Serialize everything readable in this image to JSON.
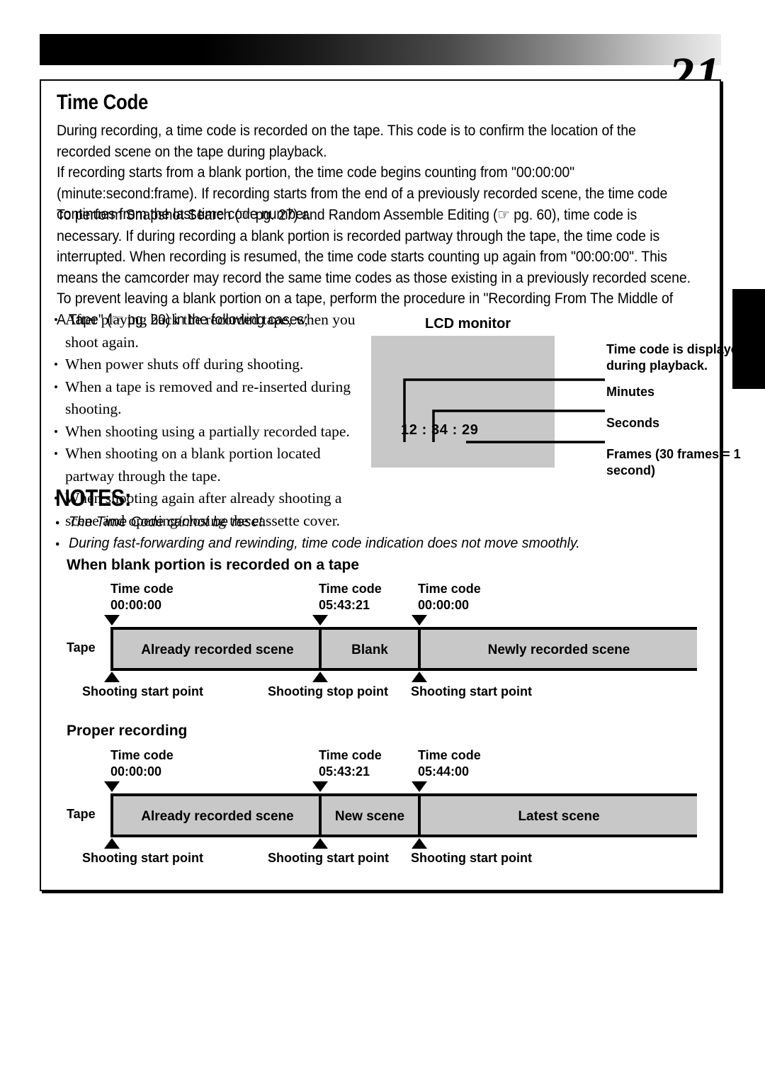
{
  "page": {
    "number": "21",
    "section_title": "Time Code"
  },
  "body": {
    "paragraph_1": "During recording, a time code is recorded on the tape. This code is to confirm the location of the\nrecorded scene on the tape during playback.\nIf recording starts from a blank portion, the time code begins counting from \"00:00:00\"\n(minute:second:frame). If recording starts from the end of a previously recorded scene, the time code\ncontinues from the last time code number.",
    "paragraph_2": "To perform Snapshot Search (☞ pg. 27) and Random Assemble Editing (☞ pg. 60), time code is\nnecessary. If during recording a blank portion is recorded partway through the tape, the time code is\ninterrupted. When recording is resumed, the time code starts counting up again from \"00:00:00\". This\nmeans the camcorder may record the same time codes as those existing in a previously recorded scene.\nTo prevent leaving a blank portion on a tape, perform the procedure in \"Recording From The Middle of\nA Tape\" (☞ pg. 20) in the following cases;"
  },
  "case_list": [
    "After playing back the recorded tape, when you shoot again.",
    "When power shuts off during shooting.",
    "When a tape is removed and re-inserted during shooting.",
    "When shooting using a partially recorded tape.",
    "When shooting on a blank portion located partway through the tape.",
    "When shooting again after already shooting a scene and opening/closing the cassette cover."
  ],
  "lcd_figure": {
    "caption": "LCD monitor",
    "timecode": "12 : 34 : 29",
    "note_playback": "Time code is displayed during playback.",
    "note_minutes": "Minutes",
    "note_seconds": "Seconds",
    "note_frames": "Frames (30 frames = 1 second)",
    "screen_color": "#c8c8c8"
  },
  "notes": {
    "title": "NOTES:",
    "items": [
      "The Time Code cannot be reset.",
      "During fast-forwarding and rewinding, time code indication does not move smoothly."
    ]
  },
  "diagrams": [
    {
      "title": "When blank portion is recorded on a tape",
      "tape_word": "Tape",
      "timecode_label": "Time code",
      "timecodes": [
        "00:00:00",
        "05:43:21",
        "00:00:00"
      ],
      "segments": [
        "Already recorded scene",
        "Blank",
        "Newly recorded scene"
      ],
      "points": [
        "Shooting start point",
        "Shooting stop point",
        "Shooting start point"
      ]
    },
    {
      "title": "Proper recording",
      "tape_word": "Tape",
      "timecode_label": "Time code",
      "timecodes": [
        "00:00:00",
        "05:43:21",
        "05:44:00"
      ],
      "segments": [
        "Already recorded scene",
        "New scene",
        "Latest scene"
      ],
      "points": [
        "Shooting start point",
        "Shooting start point",
        "Shooting start point"
      ]
    }
  ]
}
